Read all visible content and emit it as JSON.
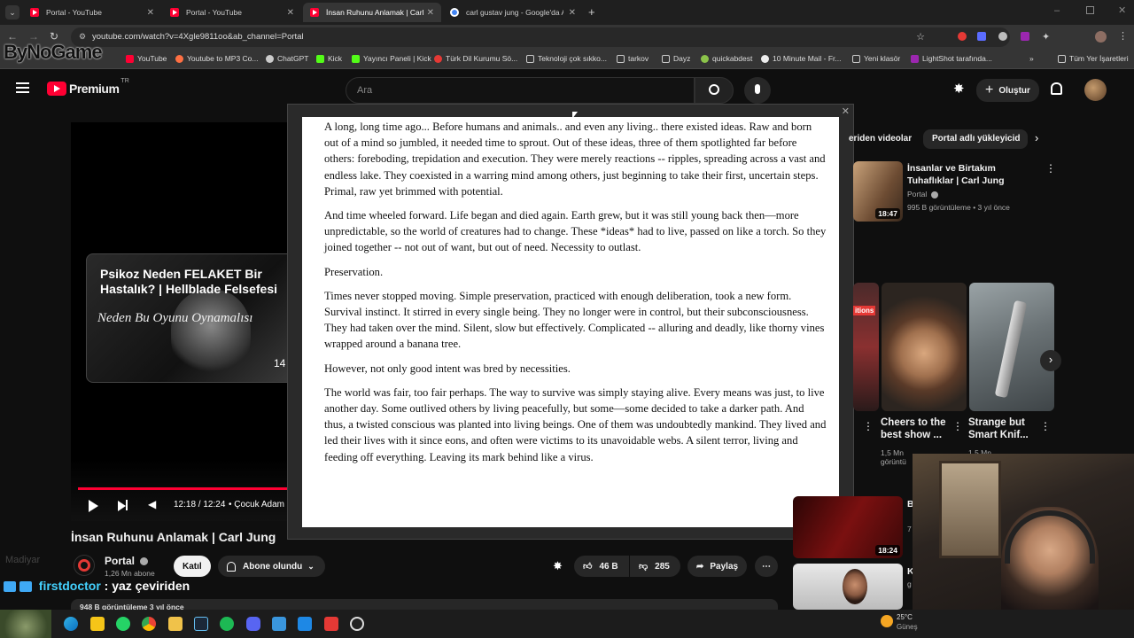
{
  "browser": {
    "tabs": [
      {
        "label": "Portal - YouTube",
        "active": false
      },
      {
        "label": "Portal - YouTube",
        "active": false
      },
      {
        "label": "İnsan Ruhunu Anlamak | Carl Ju",
        "active": true
      },
      {
        "label": "carl gustav jung - Google'da Ar",
        "active": false
      }
    ],
    "url": "youtube.com/watch?v=4Xgle9811oo&ab_channel=Portal",
    "bookmarks": [
      "YouTube",
      "Youtube to MP3 Co...",
      "ChatGPT",
      "Kick",
      "Yayıncı Paneli | Kick",
      "Türk Dil Kurumu Sö...",
      "Teknoloji çok sıkko...",
      "tarkov",
      "Dayz",
      "quickabdest",
      "10 Minute Mail - Fr...",
      "Yeni klasör",
      "LightShot tarafında..."
    ],
    "bookmarks_more": "»",
    "all_bookmarks": "Tüm Yer İşaretleri"
  },
  "overlay_logo": "ByNoGame",
  "youtube": {
    "logo": "Premium",
    "logo_sup": "TR",
    "search_placeholder": "Ara",
    "create_label": "Oluştur",
    "chips": [
      "eriden videolar",
      "Portal adlı yükleyicid"
    ]
  },
  "document": {
    "paragraphs": [
      "A long, long time ago... Before humans and animals.. and even any living.. there existed ideas. Raw and born out of a mind so jumbled, it needed time to sprout. Out of these ideas, three of them spotlighted far before others: foreboding, trepidation and execution. They were merely reactions -- ripples, spreading across a vast and endless lake. They coexisted in a warring mind among others, just beginning to take their first, uncertain steps. Primal, raw yet brimmed with potential.",
      "And time wheeled forward. Life began and died again. Earth grew, but it was still young back then—more unpredictable, so the world of creatures had to change. These *ideas* had to live, passed on like a torch. So they joined together -- not out of want, but out of need. Necessity to outlast.",
      "Preservation.",
      "Times never stopped moving. Simple preservation, practiced with enough deliberation, took a new form. Survival instinct. It stirred in every single being. They no longer were in control, but their subconsciousness. They had taken over the mind. Silent, slow but effectively.  Complicated -- alluring and deadly, like thorny vines wrapped around a banana tree.",
      "However, not only good intent was bred by necessities.",
      "The world was fair, too fair perhaps. The way to survive was simply staying alive. Every means was just, to live another day. Some outlived others by living peacefully, but some—some decided to take a darker path. And thus, a twisted conscious was planted into living beings. One of them was undoubtedly mankind. They lived and led their lives with it since eons, and often were victims to its unavoidable webs. A silent terror, living and feeding off everything. Leaving its mark behind like a virus."
    ]
  },
  "player": {
    "endcard_title": "Psikoz Neden FELAKET Bir Hastalık? | Hellblade Felsefesi",
    "endcard_subtitle": "Neden Bu Oyunu Oynamalısı",
    "endcard_dur": "14",
    "time": "12:18 / 12:24",
    "chapter": "• Çocuk Adam",
    "progress": 0.99
  },
  "video": {
    "title": "İnsan Ruhunu Anlamak | Carl Jung",
    "channel": "Portal",
    "subs": "1,26 Mn abone",
    "join": "Katıl",
    "subscribed": "Abone olundu",
    "likes": "46 B",
    "dislikes": "285",
    "share": "Paylaş",
    "views": "948 B görüntüleme  3 yıl önce"
  },
  "chat": {
    "user": "firstdoctor",
    "message": ": yaz çeviriden",
    "faded": "Madiyar"
  },
  "sidebar": {
    "video1": {
      "title": "İnsanlar ve Birtakım Tuhaflıklar | Carl Jung",
      "channel": "Portal",
      "meta": "995 B görüntüleme • 3 yıl önce",
      "dur": "18:47"
    },
    "short1": {
      "title": "Cheers to the best show ...",
      "meta": "1,5 Mn görüntü"
    },
    "short2": {
      "title": "Strange but Smart Knif...",
      "meta": "1,5 Mn"
    },
    "badge": "itions",
    "video2": {
      "dur": "18:24",
      "title_frag": "B",
      "meta_frag": "7"
    },
    "video3": {
      "title_frag": "K",
      "meta_frag": "g"
    }
  },
  "system": {
    "weather": "25°C",
    "weather_label": "Güneş"
  }
}
